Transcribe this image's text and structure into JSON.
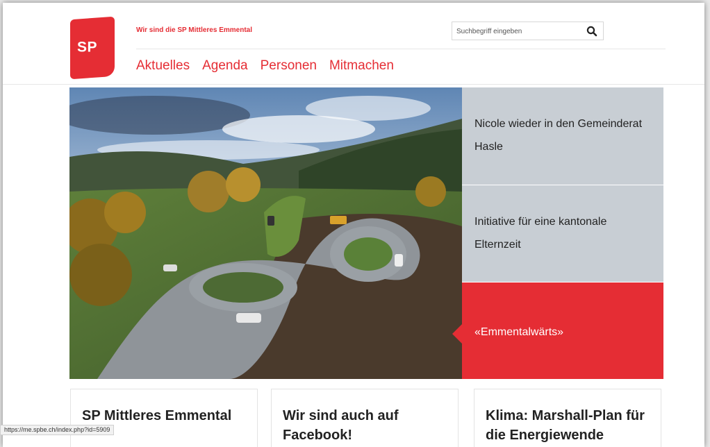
{
  "header": {
    "logo_text": "SP",
    "tagline": "Wir sind die SP Mittleres Emmental",
    "search": {
      "placeholder": "Suchbegriff eingeben",
      "icon": "search-icon"
    },
    "nav": [
      "Aktuelles",
      "Agenda",
      "Personen",
      "Mitmachen"
    ]
  },
  "colors": {
    "brand_red": "#e52d34",
    "panel_grey": "#c8ced4"
  },
  "hero": {
    "image": "aerial rendering of a road junction with roundabout in a green valley"
  },
  "teasers": [
    {
      "label": "Nicole wieder in den Gemeinderat Hasle"
    },
    {
      "label": "Initiative für eine kantonale Elternzeit"
    },
    {
      "label": "«Emmentalwärts»",
      "active": true
    }
  ],
  "cards": [
    {
      "title": "SP Mittleres Emmental"
    },
    {
      "title": "Wir sind auch auf Facebook!"
    },
    {
      "title": "Klima: Marshall-Plan für die Energiewende"
    }
  ],
  "status_bar": {
    "url": "https://me.spbe.ch/index.php?id=5909"
  }
}
